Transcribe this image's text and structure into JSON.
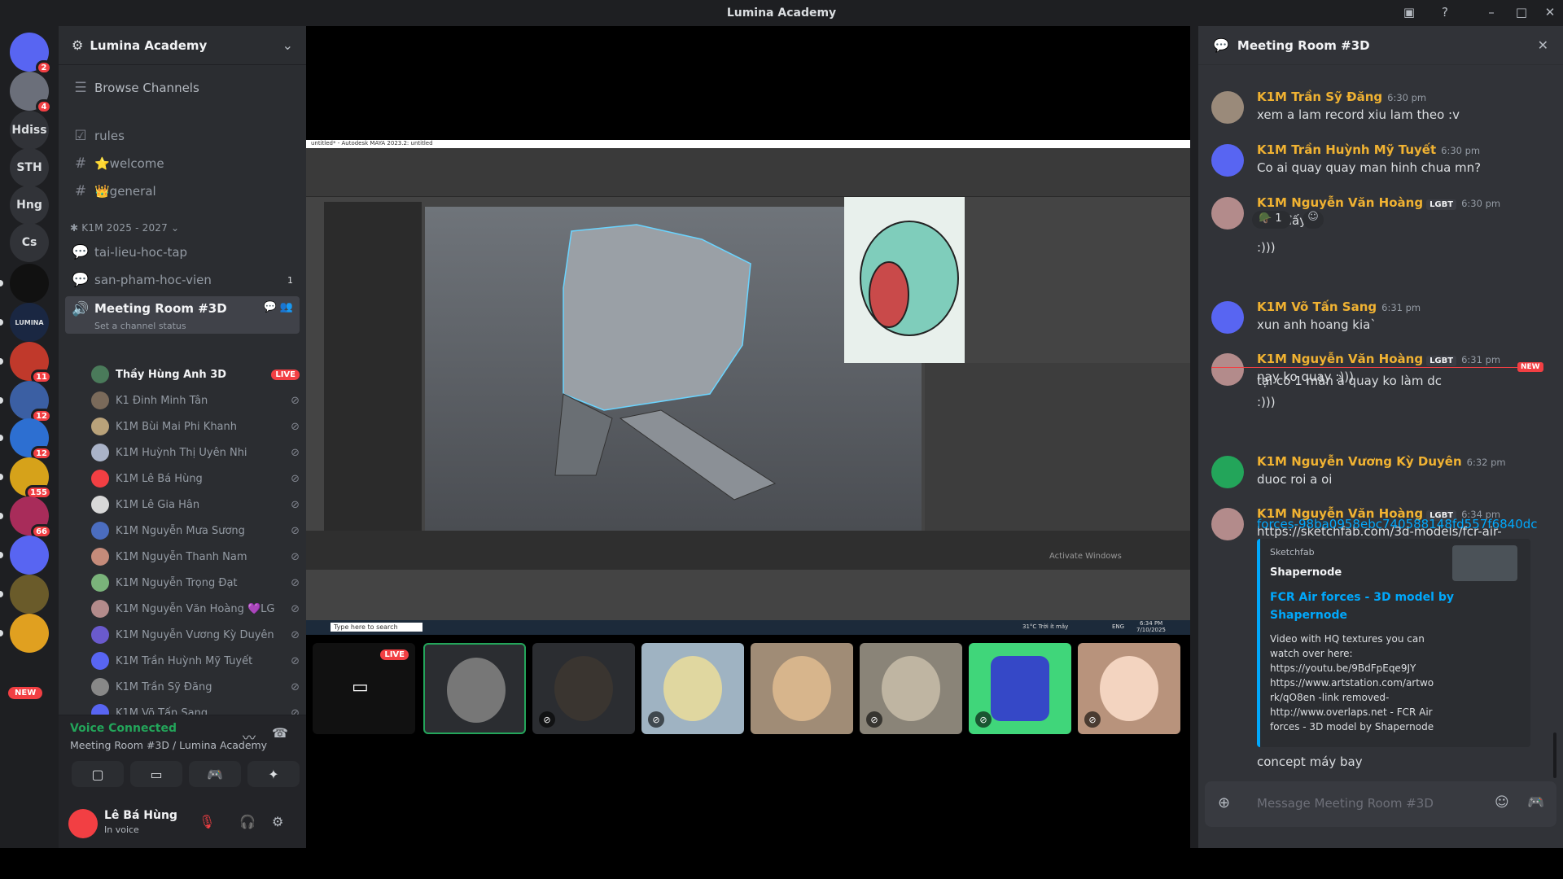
{
  "window": {
    "title": "Lumina Academy"
  },
  "rail": {
    "servers": [
      {
        "label": "",
        "badge": "2"
      },
      {
        "label": "",
        "badge": "4"
      },
      {
        "label": "Hdiss",
        "badge": ""
      },
      {
        "label": "STH",
        "badge": ""
      },
      {
        "label": "Hng",
        "badge": ""
      },
      {
        "label": "Cs",
        "badge": ""
      },
      {
        "label": "",
        "badge": ""
      },
      {
        "label": "LUMINA",
        "badge": ""
      },
      {
        "label": "",
        "badge": "11"
      },
      {
        "label": "",
        "badge": "12"
      },
      {
        "label": "",
        "badge": "12"
      },
      {
        "label": "",
        "badge": "155"
      },
      {
        "label": "",
        "badge": "66"
      },
      {
        "label": "",
        "badge": ""
      },
      {
        "label": "",
        "badge": ""
      },
      {
        "label": "",
        "badge": ""
      }
    ],
    "new_label": "NEW"
  },
  "sidebar": {
    "server_name": "Lumina Academy",
    "browse": "Browse Channels",
    "channels": [
      {
        "name": "rules",
        "icon": "rules"
      },
      {
        "name": "⭐welcome",
        "icon": "hash"
      },
      {
        "name": "👑general",
        "icon": "hash"
      }
    ],
    "category": "✱ K1M 2025 - 2027 ⌄",
    "cat_channels": [
      {
        "name": "tai-lieu-hoc-tap",
        "count": ""
      },
      {
        "name": "san-pham-hoc-vien",
        "count": "1"
      }
    ],
    "voice_channel": {
      "name": "Meeting Room #3D",
      "status": "Set a channel status"
    },
    "voice_users": [
      {
        "name": "Thầy Hùng Anh 3D",
        "live": "LIVE",
        "color": "#4a7a5a"
      },
      {
        "name": "K1 Đinh Minh Tân",
        "color": "#7a6a5a"
      },
      {
        "name": "K1M Bùi Mai Phi Khanh",
        "color": "#b9a27a"
      },
      {
        "name": "K1M Huỳnh Thị Uyên Nhi",
        "color": "#aab3c8"
      },
      {
        "name": "K1M Lê Bá Hùng",
        "color": "#f23f43"
      },
      {
        "name": "K1M Lê Gia Hân",
        "color": "#d8d8d8"
      },
      {
        "name": "K1M Nguyễn Mưa Sương",
        "color": "#4b6dbf"
      },
      {
        "name": "K1M Nguyễn Thanh Nam",
        "color": "#c58b7a"
      },
      {
        "name": "K1M Nguyễn Trọng Đạt",
        "color": "#7ab37a"
      },
      {
        "name": "K1M Nguyễn Văn Hoàng 💜LG",
        "color": "#b38b8b"
      },
      {
        "name": "K1M Nguyễn Vương Kỳ Duyên",
        "color": "#6a5acd"
      },
      {
        "name": "K1M Trần Huỳnh Mỹ Tuyết",
        "color": "#5865f2"
      },
      {
        "name": "K1M Trần Sỹ Đăng",
        "color": "#888"
      },
      {
        "name": "K1M Võ Tấn Sang",
        "color": "#5865f2"
      }
    ]
  },
  "voice_panel": {
    "status": "Voice Connected",
    "location": "Meeting Room #3D / Lumina Academy"
  },
  "user": {
    "name": "Lê Bá Hùng",
    "status": "In voice"
  },
  "maya": {
    "window_title": "untitled* - Autodesk MAYA 2023.2: untitled",
    "taskbar_search": "Type here to search",
    "watermark": "Activate Windows",
    "weather": "31°C  Trời ít mây",
    "lang": "ENG",
    "clock": "6:34 PM",
    "date": "7/10/2025"
  },
  "tiles": {
    "live": "LIVE"
  },
  "chat": {
    "title": "Meeting Room #3D",
    "messages": [
      {
        "author": "K1M Trần Sỹ Đăng",
        "time": "6:30 pm",
        "text": "xem a lam record xiu lam theo :v",
        "lgbt": false,
        "color": "#9a8a7a"
      },
      {
        "author": "K1M Trần Huỳnh Mỹ Tuyết",
        "time": "6:30 pm",
        "text": "Co ai quay quay man hinh chua mn?",
        "lgbt": false,
        "color": "#5865f2"
      },
      {
        "author": "K1M Nguyễn Văn Hoàng",
        "time": "6:30 pm",
        "text": "bait đấy",
        "lgbt": true,
        "color": "#b38b8b"
      },
      {
        "author": "K1M Võ Tấn Sang",
        "time": "6:31 pm",
        "text": "xun anh hoang kia`",
        "lgbt": false,
        "color": "#5865f2"
      },
      {
        "author": "K1M Nguyễn Văn Hoàng",
        "time": "6:31 pm",
        "text": "nay ko quay :)))",
        "lgbt": true,
        "color": "#b38b8b"
      },
      {
        "author": "K1M Nguyễn Vương Kỳ Duyên",
        "time": "6:32 pm",
        "text": "duoc roi a oi",
        "lgbt": false,
        "color": "#23a55a"
      },
      {
        "author": "K1M Nguyễn Văn Hoàng",
        "time": "6:34 pm",
        "text": "https://sketchfab.com/3d-models/fcr-air-",
        "lgbt": true,
        "color": "#b38b8b"
      }
    ],
    "extra": {
      "smile": ":)))",
      "reaction_count": "1",
      "followup1": "tại có 1 màn à quay ko làm dc",
      "followup2": ":)))",
      "new": "NEW",
      "link2": "forces-98ba0958ebc740588148fd557f6840dc",
      "lgbt": "LGBT",
      "concept": "concept máy bay"
    },
    "embed": {
      "provider": "Sketchfab",
      "author": "Shapernode",
      "title1": "FCR Air forces - 3D model by",
      "title2": "Shapernode",
      "desc": [
        "Video with HQ textures you can",
        "watch over here:",
        "https://youtu.be/9BdFpEqe9JY",
        "https://www.artstation.com/artwo",
        "rk/qO8en -link removed-",
        "http://www.overlaps.net - FCR Air",
        "forces - 3D model by Shapernode"
      ]
    },
    "composer_placeholder": "Message Meeting Room #3D"
  },
  "colors": {
    "bg": "#1e1f22",
    "sidebar": "#2b2d31",
    "chat": "#313338",
    "accent": "#5865f2",
    "green": "#23a55a",
    "red": "#f23f43",
    "name_gold": "#f0b232",
    "link": "#00a8fc"
  }
}
